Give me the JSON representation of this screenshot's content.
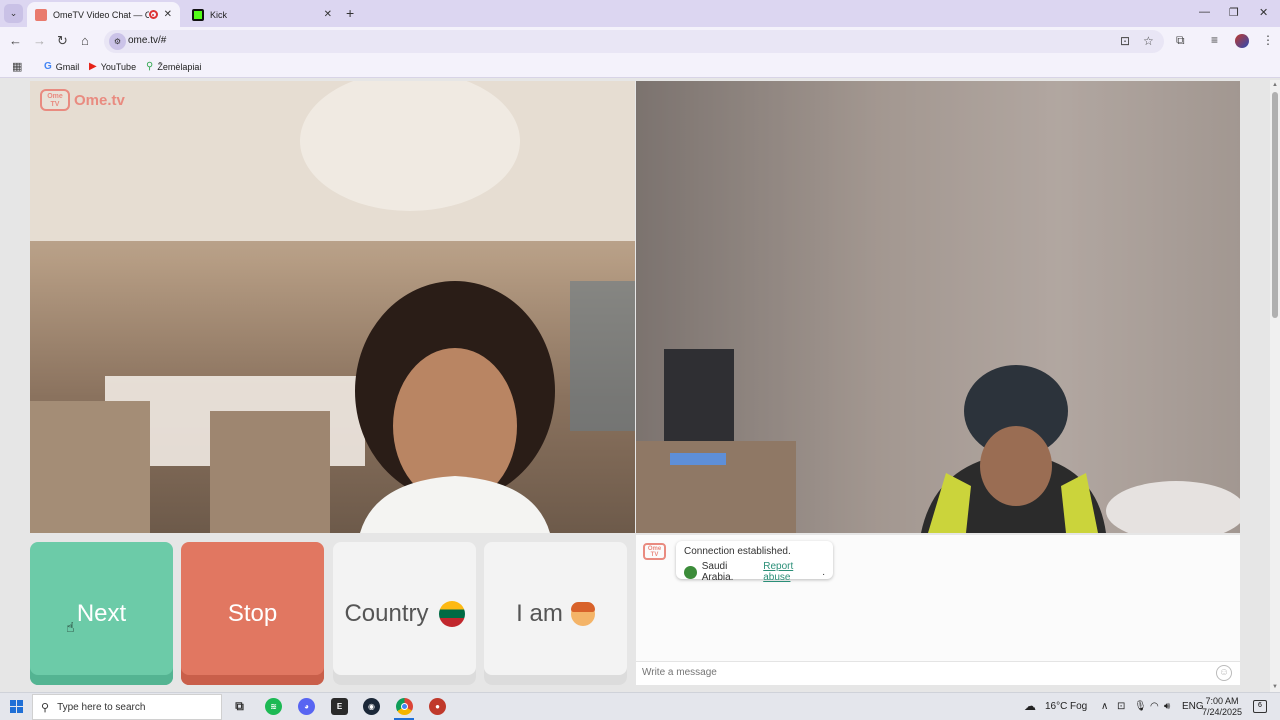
{
  "browser": {
    "tabs": [
      {
        "title": "OmeTV Video Chat — Ome",
        "active": true
      },
      {
        "title": "Kick",
        "active": false
      }
    ],
    "url": "ome.tv/#",
    "bookmarks": [
      {
        "label": "Gmail",
        "icon": "google-icon"
      },
      {
        "label": "YouTube",
        "icon": "youtube-icon"
      },
      {
        "label": "Žemėlapiai",
        "icon": "maps-pin-icon"
      }
    ]
  },
  "site": {
    "logo_badge": "Ome TV",
    "logo_text": "Ome.tv"
  },
  "controls": {
    "next_label": "Next",
    "stop_label": "Stop",
    "country_label": "Country",
    "iam_label": "I am"
  },
  "chat": {
    "logo": "Ome TV",
    "status": "Connection established.",
    "country": "Saudi Arabia.",
    "report_link": "Report abuse",
    "report_suffix": ".",
    "input_placeholder": "Write a message"
  },
  "taskbar": {
    "search_placeholder": "Type here to search",
    "weather_temp": "16°C",
    "weather_desc": "Fog",
    "language": "ENG",
    "time": "7:00 AM",
    "date": "7/24/2025"
  },
  "colors": {
    "next": "#6ccba8",
    "stop": "#e17761",
    "brand": "#e98b80",
    "tabstrip": "#dcd6f1"
  }
}
